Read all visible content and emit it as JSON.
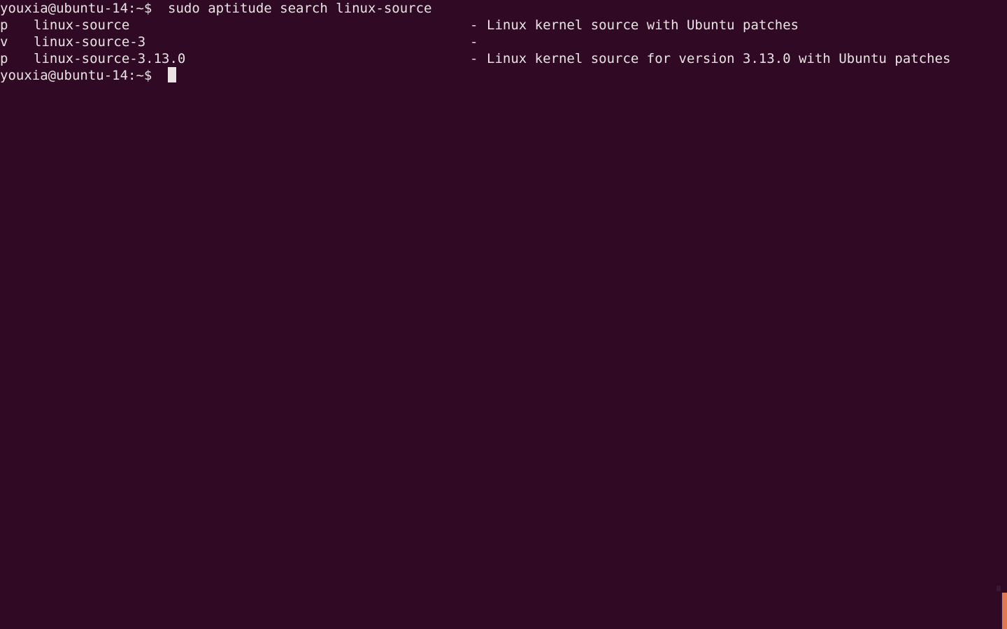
{
  "terminal": {
    "background_color": "#300a24",
    "foreground_color": "#e9e4e3",
    "cursor_color": "#e9e4e3",
    "accent_color": "#e0784f",
    "prompt": "youxia@ubuntu-14:~$",
    "command": "sudo aptitude search linux-source",
    "lines": [
      {
        "type": "prompt",
        "prompt": "youxia@ubuntu-14:~$",
        "command": "sudo aptitude search linux-source",
        "full_text": "youxia@ubuntu-14:~$ sudo aptitude search linux-source"
      },
      {
        "type": "result",
        "state": "p",
        "package": "linux-source",
        "separator": "-",
        "description": "Linux kernel source with Ubuntu patches"
      },
      {
        "type": "result",
        "state": "v",
        "package": "linux-source-3",
        "separator": "-",
        "description": ""
      },
      {
        "type": "result",
        "state": "p",
        "package": "linux-source-3.13.0",
        "separator": "-",
        "description": "Linux kernel source for version 3.13.0 with Ubuntu patches"
      },
      {
        "type": "prompt",
        "prompt": "youxia@ubuntu-14:~$",
        "command": "",
        "full_text": "youxia@ubuntu-14:~$"
      }
    ]
  }
}
